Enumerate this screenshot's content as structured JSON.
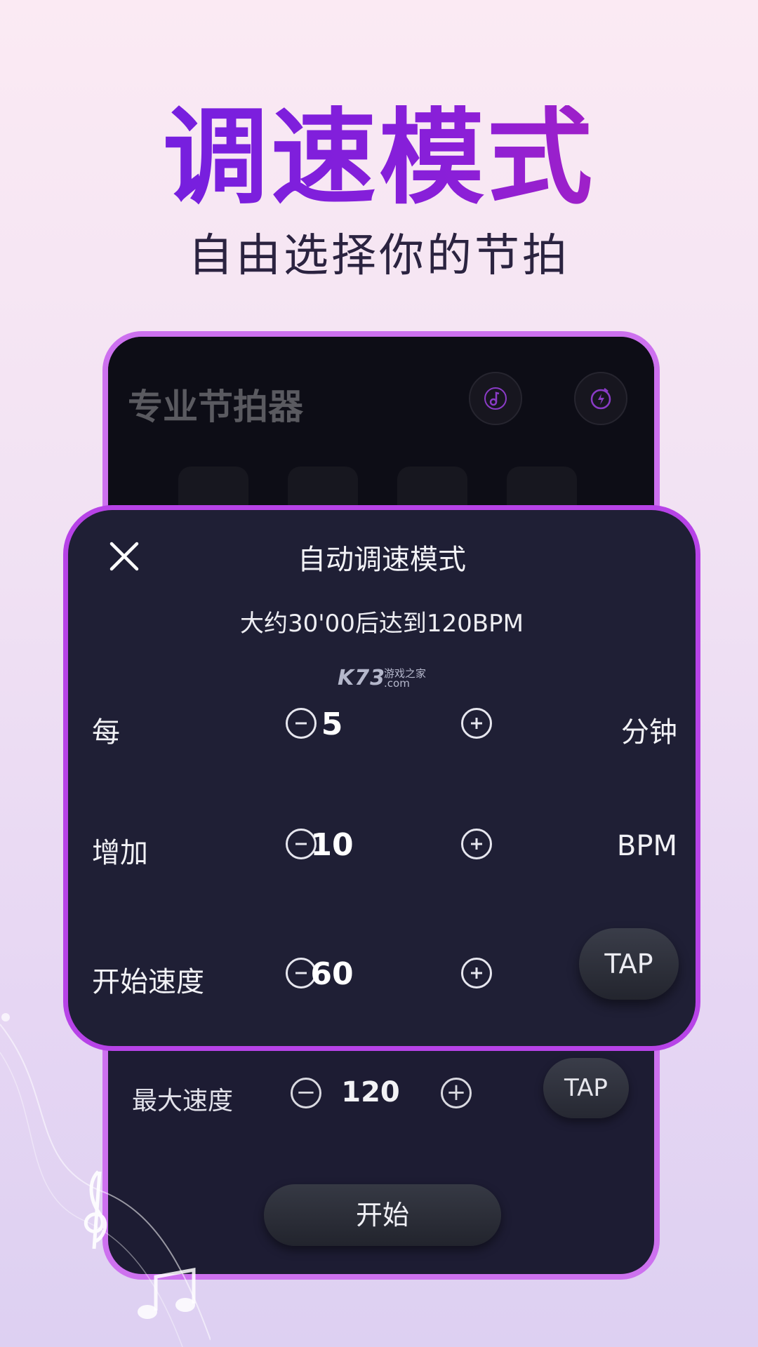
{
  "header": {
    "headline": "调速模式",
    "subline": "自由选择你的节拍"
  },
  "app": {
    "title": "专业节拍器",
    "icons": [
      "music-note-icon",
      "timer-bolt-icon"
    ]
  },
  "dialog": {
    "title": "自动调速模式",
    "summary": "大约30'00后达到120BPM",
    "watermark": {
      "main": "K73",
      "side_top": "游戏之家",
      "side_bottom": ".com"
    },
    "rows": [
      {
        "label": "每",
        "value": "5",
        "unit": "分钟"
      },
      {
        "label": "增加",
        "value": "10",
        "unit": "BPM"
      },
      {
        "label": "开始速度",
        "value": "60",
        "tap": "TAP"
      }
    ]
  },
  "behind_row": {
    "label": "最大速度",
    "value": "120",
    "tap": "TAP"
  },
  "start_button": "开始",
  "colors": {
    "headline_gradient_start": "#6a1fe3",
    "headline_gradient_end": "#b822b5",
    "card_bg": "#1f1f35",
    "card_border": "#b743e7",
    "phone_border": "#cd71ef"
  }
}
